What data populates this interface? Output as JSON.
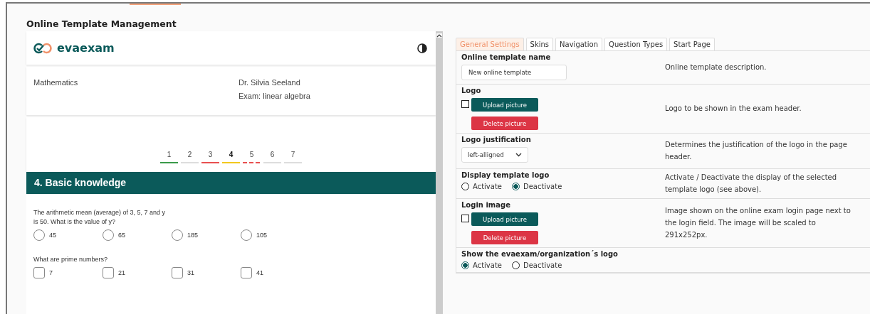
{
  "page_title": "Online Template Management",
  "preview": {
    "brand": "evaexam",
    "subject": "Mathematics",
    "teacher": "Dr. Silvia Seeland",
    "exam": "Exam: linear algebra",
    "steps": [
      {
        "label": "1",
        "color": "#3a9a4a",
        "kind": "solid",
        "selected": false
      },
      {
        "label": "2",
        "color": "#dddddd",
        "kind": "solid",
        "selected": false
      },
      {
        "label": "3",
        "color": "#e85050",
        "kind": "solid",
        "selected": false
      },
      {
        "label": "4",
        "color": "#f2c81e",
        "kind": "solid",
        "selected": true
      },
      {
        "label": "5",
        "color": "#e85050",
        "kind": "dashed",
        "selected": false
      },
      {
        "label": "6",
        "color": "#dddddd",
        "kind": "solid",
        "selected": false
      },
      {
        "label": "7",
        "color": "#dddddd",
        "kind": "solid",
        "selected": false
      }
    ],
    "section_title": "4. Basic knowledge",
    "questions": [
      {
        "kind": "radio",
        "text": "The arithmetic mean (average) of 3, 5, 7 and y\nis 50. What is the value of y?",
        "options": [
          {
            "label": "45",
            "checked": false
          },
          {
            "label": "65",
            "checked": false
          },
          {
            "label": "185",
            "checked": false
          },
          {
            "label": "105",
            "checked": false
          }
        ]
      },
      {
        "kind": "checkbox",
        "text": "What are prime numbers?",
        "options": [
          {
            "label": "7",
            "checked": false
          },
          {
            "label": "21",
            "checked": false
          },
          {
            "label": "31",
            "checked": false
          },
          {
            "label": "41",
            "checked": false
          }
        ]
      }
    ]
  },
  "tabs": [
    {
      "label": "General Settings",
      "selected": true
    },
    {
      "label": "Skins",
      "selected": false
    },
    {
      "label": "Navigation",
      "selected": false
    },
    {
      "label": "Question Types",
      "selected": false
    },
    {
      "label": "Start Page",
      "selected": false
    }
  ],
  "settings": [
    {
      "kind": "text",
      "label": "Online template name",
      "value": "New online template",
      "description": "Online template description."
    },
    {
      "kind": "picture",
      "label": "Logo",
      "checked": false,
      "upload": "Upload picture",
      "delete": "Delete picture",
      "description": "Logo to be shown in the exam header."
    },
    {
      "kind": "select",
      "label": "Logo justification",
      "value": "left-alligned",
      "description": "Determines the justification of the logo in the page header."
    },
    {
      "kind": "radio",
      "label": "Display template logo",
      "options": [
        {
          "label": "Activate",
          "selected": false
        },
        {
          "label": "Deactivate",
          "selected": true
        }
      ],
      "description": "Activate / Deactivate the display of the selected template logo (see above)."
    },
    {
      "kind": "picture",
      "label": "Login image",
      "checked": false,
      "upload": "Upload picture",
      "delete": "Delete picture",
      "description": "Image shown on the online exam login page next to the login field. The image will be scaled to 291x252px."
    },
    {
      "kind": "radio",
      "label": "Show the evaexam/organization´s logo",
      "options": [
        {
          "label": "Activate",
          "selected": true
        },
        {
          "label": "Deactivate",
          "selected": false
        }
      ]
    }
  ]
}
